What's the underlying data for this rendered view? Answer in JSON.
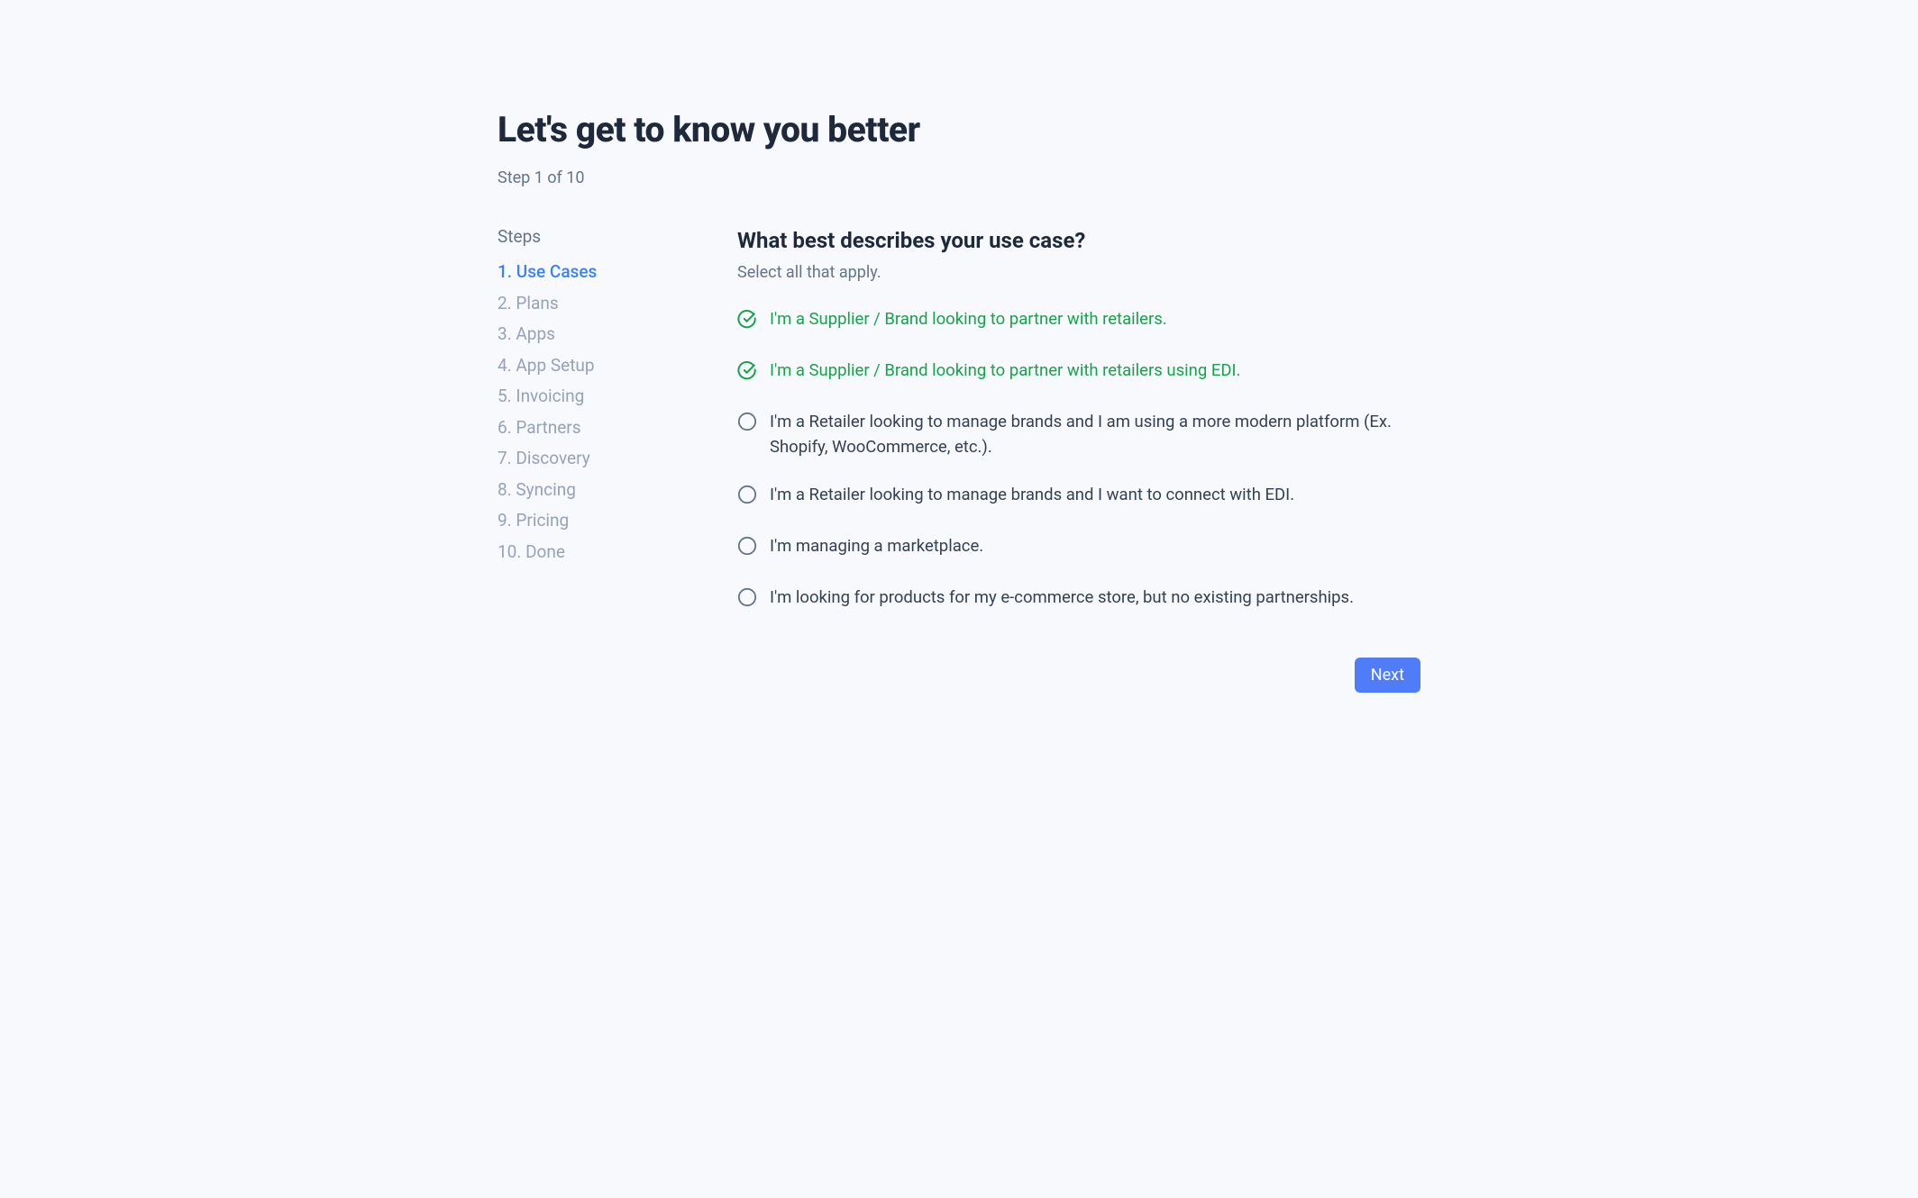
{
  "header": {
    "title": "Let's get to know you better",
    "step_indicator": "Step 1 of 10"
  },
  "sidebar": {
    "heading": "Steps",
    "steps": [
      {
        "number": 1,
        "label": "1. Use Cases",
        "active": true
      },
      {
        "number": 2,
        "label": "2. Plans",
        "active": false
      },
      {
        "number": 3,
        "label": "3. Apps",
        "active": false
      },
      {
        "number": 4,
        "label": "4. App Setup",
        "active": false
      },
      {
        "number": 5,
        "label": "5. Invoicing",
        "active": false
      },
      {
        "number": 6,
        "label": "6. Partners",
        "active": false
      },
      {
        "number": 7,
        "label": "7. Discovery",
        "active": false
      },
      {
        "number": 8,
        "label": "8. Syncing",
        "active": false
      },
      {
        "number": 9,
        "label": "9. Pricing",
        "active": false
      },
      {
        "number": 10,
        "label": "10. Done",
        "active": false
      }
    ]
  },
  "question": {
    "title": "What best describes your use case?",
    "subtitle": "Select all that apply.",
    "options": [
      {
        "label": "I'm a Supplier / Brand looking to partner with retailers.",
        "selected": true
      },
      {
        "label": "I'm a Supplier / Brand looking to partner with retailers using EDI.",
        "selected": true
      },
      {
        "label": "I'm a Retailer looking to manage brands and I am using a more modern platform (Ex. Shopify, WooCommerce, etc.).",
        "selected": false
      },
      {
        "label": "I'm a Retailer looking to manage brands and I want to connect with EDI.",
        "selected": false
      },
      {
        "label": "I'm managing a marketplace.",
        "selected": false
      },
      {
        "label": "I'm looking for products for my e-commerce store, but no existing partnerships.",
        "selected": false
      }
    ]
  },
  "buttons": {
    "next": "Next"
  },
  "colors": {
    "background": "#f8f9fc",
    "primary": "#4f7df9",
    "text_dark": "#1e293b",
    "text_muted": "#64748b",
    "text_light": "#94a3b8",
    "selected_green": "#16a34a"
  }
}
